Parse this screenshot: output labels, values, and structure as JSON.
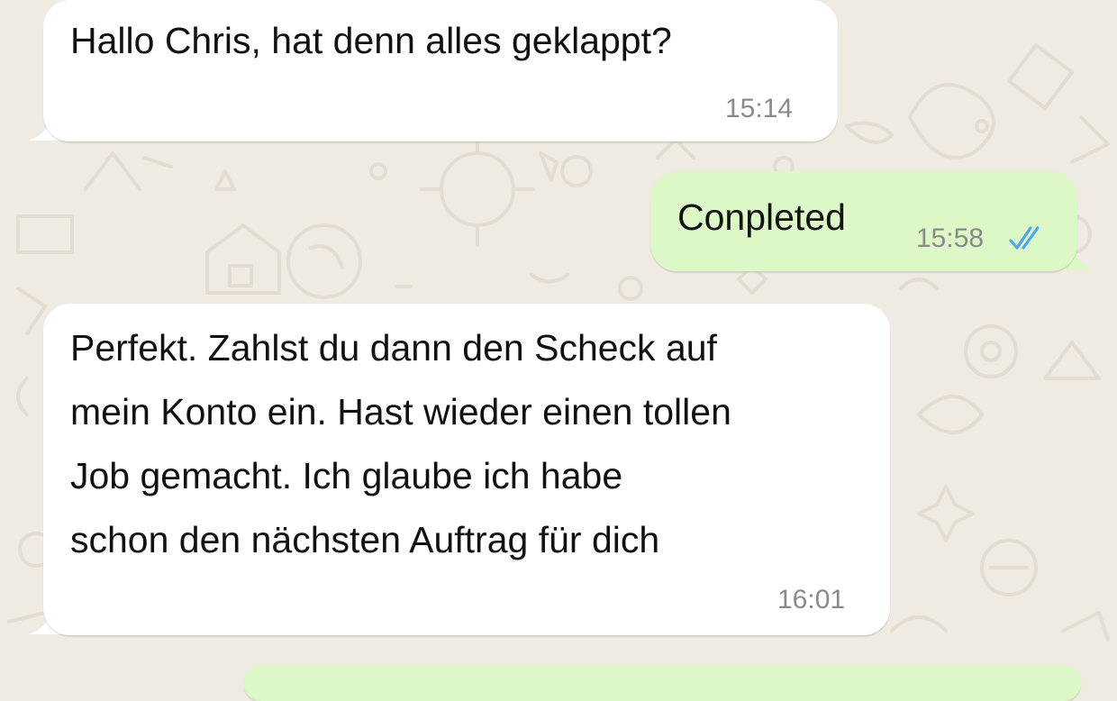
{
  "chat": {
    "messages": [
      {
        "direction": "incoming",
        "text": "Hallo Chris, hat denn alles geklappt?",
        "time": "15:14"
      },
      {
        "direction": "outgoing",
        "text": "Conpleted",
        "time": "15:58",
        "status": "read",
        "status_icon": "double-check-icon"
      },
      {
        "direction": "incoming",
        "text": "Perfekt. Zahlst du dann den Scheck auf\nmein Konto ein. Hast wieder einen tollen\nJob gemacht. Ich glaube ich habe\nschon den nächsten Auftrag für dich",
        "time": "16:01"
      }
    ]
  },
  "theme": {
    "background": "#EFEAE2",
    "incoming_bubble": "#FFFFFF",
    "outgoing_bubble": "#DCF8C6",
    "timestamp_color": "#8A8A8A",
    "read_tick_color": "#4FA6F0"
  }
}
